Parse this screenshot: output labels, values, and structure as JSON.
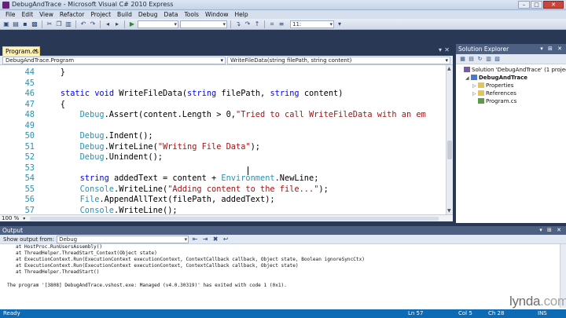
{
  "window": {
    "title": "DebugAndTrace - Microsoft Visual C# 2010 Express"
  },
  "menu": [
    "File",
    "Edit",
    "View",
    "Refactor",
    "Project",
    "Build",
    "Debug",
    "Data",
    "Tools",
    "Window",
    "Help"
  ],
  "toolbar": {
    "line_combo": "11:"
  },
  "editor": {
    "tab_label": "Program.cs",
    "nav_left": "DebugAndTrace.Program",
    "nav_right": "WriteFileData(string filePath, string content)",
    "zoom": "100 %",
    "lines": [
      {
        "num": "44",
        "text": "    }"
      },
      {
        "num": "45",
        "text": ""
      },
      {
        "num": "46",
        "text": "    static void WriteFileData(string filePath, string content)"
      },
      {
        "num": "47",
        "text": "    {"
      },
      {
        "num": "48",
        "text": "        Debug.Assert(content.Length > 0,\"Tried to call WriteFileData with an em"
      },
      {
        "num": "49",
        "text": ""
      },
      {
        "num": "50",
        "text": "        Debug.Indent();"
      },
      {
        "num": "51",
        "text": "        Debug.WriteLine(\"Writing File Data\");"
      },
      {
        "num": "52",
        "text": "        Debug.Unindent();"
      },
      {
        "num": "53",
        "text": ""
      },
      {
        "num": "54",
        "text": "        string addedText = content + Environment.NewLine;"
      },
      {
        "num": "55",
        "text": "        Console.WriteLine(\"Adding content to the file...\");"
      },
      {
        "num": "56",
        "text": "        File.AppendAllText(filePath, addedText);"
      },
      {
        "num": "57",
        "text": "        Console.WriteLine();"
      }
    ]
  },
  "solution_explorer": {
    "title": "Solution Explorer",
    "items": [
      {
        "label": "Solution 'DebugAndTrace' (1 project)",
        "depth": 0,
        "kind": "sol",
        "expander": ""
      },
      {
        "label": "DebugAndTrace",
        "depth": 1,
        "kind": "proj",
        "expander": "◢"
      },
      {
        "label": "Properties",
        "depth": 2,
        "kind": "folder",
        "expander": "▷"
      },
      {
        "label": "References",
        "depth": 2,
        "kind": "folder",
        "expander": "▷"
      },
      {
        "label": "Program.cs",
        "depth": 2,
        "kind": "file",
        "expander": ""
      }
    ]
  },
  "output": {
    "title": "Output",
    "show_label": "Show output from:",
    "source": "Debug",
    "lines": [
      "   at HostProc.RunUsersAssembly()",
      "   at ThreadHelper.ThreadStart_Context(Object state)",
      "   at ExecutionContext.Run(ExecutionContext executionContext, ContextCallback callback, Object state, Boolean ignoreSyncCtx)",
      "   at ExecutionContext.Run(ExecutionContext executionContext, ContextCallback callback, Object state)",
      "   at ThreadHelper.ThreadStart()",
      "",
      "The program '[3808] DebugAndTrace.vshost.exe: Managed (v4.0.30319)' has exited with code 1 (0x1)."
    ]
  },
  "status": {
    "ready": "Ready",
    "ln": "Ln 57",
    "col": "Col 5",
    "ch": "Ch 28",
    "ins": "INS"
  },
  "watermark": {
    "brand": "lynda",
    "suffix": ".com"
  }
}
